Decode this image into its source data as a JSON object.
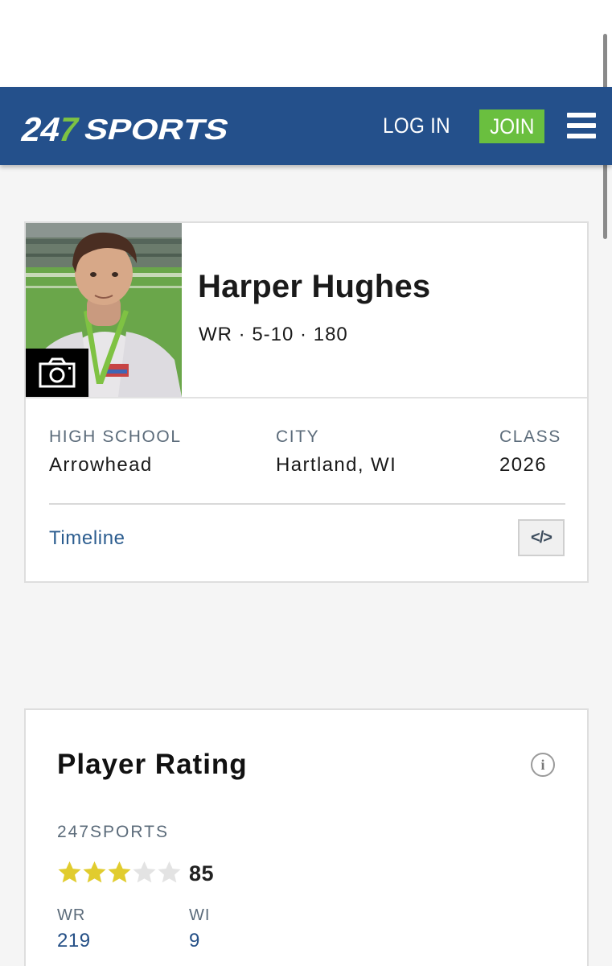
{
  "header": {
    "logo_text": "247SPORTS",
    "login_label": "LOG IN",
    "join_label": "JOIN",
    "menu_icon": "hamburger-menu-icon",
    "colors": {
      "navbar": "#24508b",
      "join_button": "#6abf3f",
      "logo_accent": "#7dc243"
    }
  },
  "player": {
    "name": "Harper Hughes",
    "position": "WR",
    "height": "5-10",
    "weight": "180",
    "photo_icon": "camera-icon",
    "info": [
      {
        "label": "HIGH SCHOOL",
        "value": "Arrowhead"
      },
      {
        "label": "CITY",
        "value": "Hartland, WI"
      },
      {
        "label": "CLASS",
        "value": "2026"
      }
    ],
    "timeline_label": "Timeline",
    "embed_icon": "</>"
  },
  "rating": {
    "title": "Player Rating",
    "info_icon": "i",
    "source": "247SPORTS",
    "stars_filled": 3,
    "stars_total": 5,
    "score": "85",
    "ranks": [
      {
        "label": "WR",
        "value": "219"
      },
      {
        "label": "WI",
        "value": "9"
      }
    ],
    "colors": {
      "star_filled": "#e1cc2e",
      "star_empty": "#e3e3e3"
    }
  }
}
